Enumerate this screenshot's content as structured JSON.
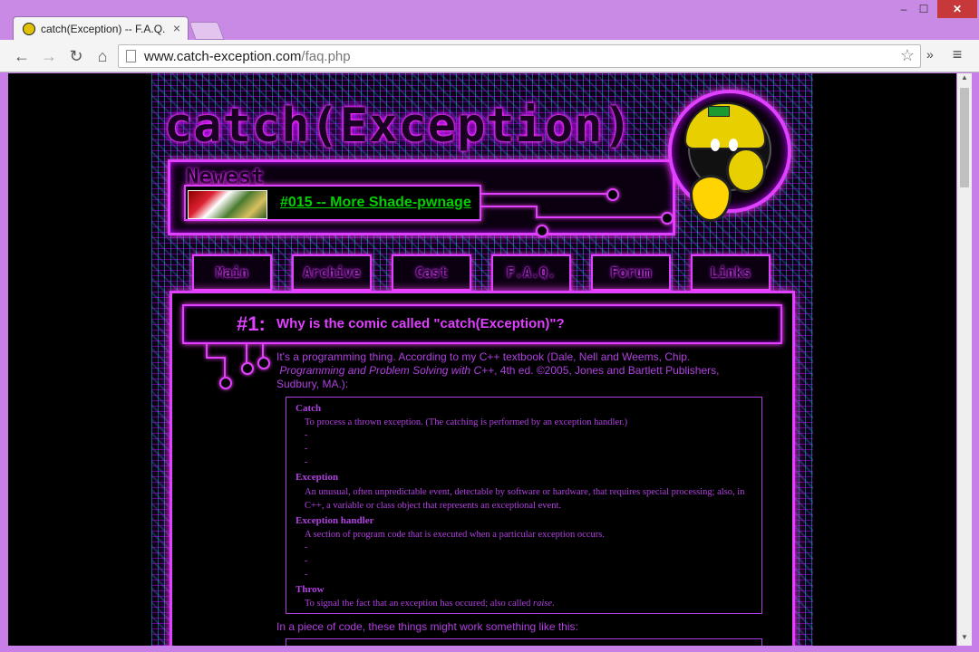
{
  "browser": {
    "tab_title": "catch(Exception) -- F.A.Q.",
    "tab_close": "×",
    "url_domain": "www.catch-exception.com",
    "url_path": "/faq.php",
    "min_glyph": "–",
    "max_glyph": "☐",
    "close_glyph": "✕",
    "back_glyph": "←",
    "forward_glyph": "→",
    "reload_glyph": "↻",
    "home_glyph": "⌂",
    "star_glyph": "☆",
    "ext_glyph": "»",
    "menu_glyph": "≡",
    "scroll_up": "▲",
    "scroll_down": "▼"
  },
  "site": {
    "logo": "catch(Exception)",
    "newest_label": "Newest",
    "newest_link": "#015 -- More Shade-pwnage",
    "nav": [
      "Main",
      "Archive",
      "Cast",
      "F.A.Q.",
      "Forum",
      "Links"
    ]
  },
  "faq": {
    "q1_num": "#1:",
    "q1_text": "Why is the comic called \"catch(Exception)\"?",
    "intro_line1": "It's a programming thing.  According to my C++ textbook (Dale, Nell and Weems, Chip.",
    "intro_book": "Programming and Problem Solving with C++",
    "intro_line2_rest": ", 4th ed. ©2005, Jones and Bartlett Publishers,",
    "intro_line3": "Sudbury, MA.):",
    "defs": [
      {
        "term": "Catch",
        "text": "To process a thrown exception.  (The catching is performed by an exception handler.)"
      },
      {
        "term": "Exception",
        "text": "An unusual, often unpredictable event, detectable by software or hardware, that requires special processing; also, in C++, a variable or class object that represents an exceptional event."
      },
      {
        "term": "Exception handler",
        "text": "A section of program code that is executed when a particular exception occurs."
      },
      {
        "term": "Throw",
        "text_main": "To signal the fact that an exception has occured; also called ",
        "text_italic": "raise",
        "text_end": "."
      }
    ],
    "dash": "-",
    "code_intro": "In a piece of code, these things might work something like this:"
  },
  "colors": {
    "neon_magenta": "#e040ff",
    "link_green": "#00d000",
    "text_purple": "#b040e0",
    "browser_frame": "#c77ee6"
  }
}
